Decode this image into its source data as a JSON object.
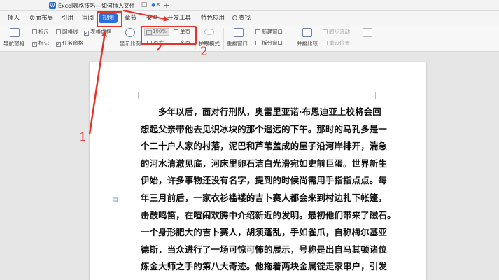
{
  "titlebar": {
    "doc_icon_letter": "W",
    "doc_title": "Excel表格技巧---如何插入文件",
    "monitor_glyph": "□",
    "dot_glyph": "●",
    "close_glyph": "×",
    "add_glyph": "+"
  },
  "menu": {
    "items": [
      "插入",
      "页面布局",
      "引用",
      "审阅",
      "视图",
      "章节",
      "安全",
      "开发工具",
      "特色应用"
    ],
    "search_label": "查找",
    "active_item": "视图"
  },
  "toolbar": {
    "nav_pane": "导航窗格",
    "ruler": "标尺",
    "gridlines": "网格线",
    "table_gridlines": "表格虚框",
    "markup": "标记",
    "task_pane": "任务窗格",
    "show_scale": "显示比例",
    "zoom_value": "100%",
    "single_page": "单页",
    "page_width": "页宽",
    "multi_page": "多页",
    "eye_protection": "护眼模式",
    "rearrange_windows": "重排窗口",
    "new_window": "新建窗口",
    "split_window": "拆分窗口",
    "side_by_side": "并排比较",
    "sync_scroll": "同步滚动",
    "reset_position": "重设位置",
    "check_glyph": "✓"
  },
  "document": {
    "lines": [
      "多年以后，面对行刑队，奥雷里亚诺·布恩迪亚上校将会回",
      "想起父亲带他去见识冰块的那个遥远的下午。那时的马孔多是一",
      "个二十户人家的村落，泥巴和芦苇盖成的屋子沿河岸排开，湍急",
      "的河水清澈见底，河床里卵石洁白光滑宛如史前巨蛋。世界新生",
      "伊始，许多事物还没有名字，提到的时候尚需用手指指点点。每",
      "年三月前后，一家衣衫褴褛的吉卜赛人都会来到村边扎下帐篷，",
      "击鼓鸣笛，在喧闹欢腾中介绍新近的发明。最初他们带来了磁石。",
      "一个身形肥大的吉卜赛人，胡须蓬乱，手如雀爪，自称梅尔基亚",
      "德斯，当众进行了一场可惊可怖的展示，号称是出自马其顿诸位",
      "炼金大师之手的第八大奇迹。他拖着两块金属锭走家串户，引发"
    ],
    "margin_icon": "▤"
  },
  "annotations": {
    "label_1": "1",
    "label_2": "2",
    "color": "#e5332a"
  }
}
